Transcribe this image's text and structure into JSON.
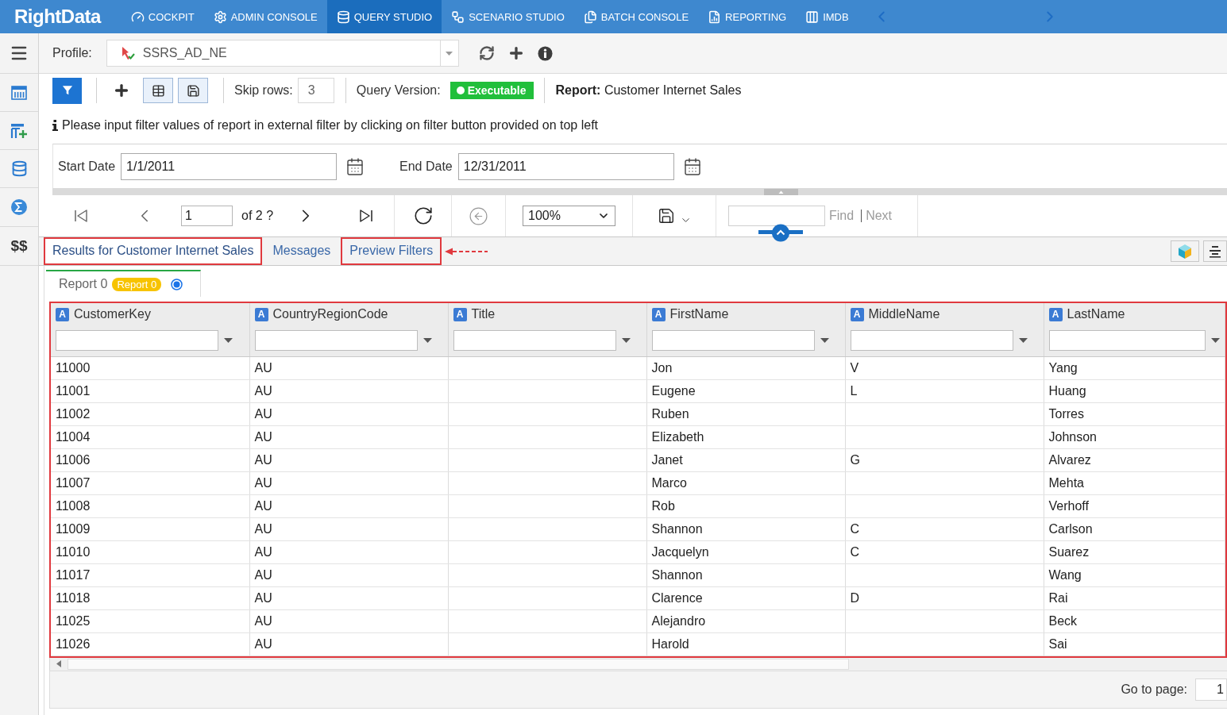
{
  "nav": {
    "logo": "RightData",
    "items": [
      {
        "label": "COCKPIT",
        "selected": false
      },
      {
        "label": "ADMIN CONSOLE",
        "selected": false
      },
      {
        "label": "QUERY STUDIO",
        "selected": true
      },
      {
        "label": "SCENARIO STUDIO",
        "selected": false
      },
      {
        "label": "BATCH CONSOLE",
        "selected": false
      },
      {
        "label": "REPORTING",
        "selected": false
      },
      {
        "label": "IMDB",
        "selected": false
      }
    ]
  },
  "sidebar": {
    "currency_label": "$$"
  },
  "profile": {
    "label": "Profile:",
    "value": "SSRS_AD_NE"
  },
  "toolbar": {
    "skip_rows_label": "Skip rows:",
    "skip_rows_value": "3",
    "query_version_label": "Query Version:",
    "query_version_status": "Executable",
    "report": "**Report:** Customer Internet Sales"
  },
  "info_message": "Please input filter values of report in external filter by clicking on filter button provided on top left",
  "parameters": [
    {
      "label": "Start Date",
      "value": "1/1/2011"
    },
    {
      "label": "End Date",
      "value": "12/31/2011"
    }
  ],
  "report_toolbar": {
    "page": "1",
    "page_count": "of 2 ?",
    "zoom": "100%",
    "find_label": "Find",
    "next_label": "Next"
  },
  "result_tabs": [
    {
      "label": "Results for Customer Internet Sales",
      "selected": true,
      "highlighted": true,
      "arrow": false
    },
    {
      "label": "Messages",
      "selected": false,
      "highlighted": false,
      "arrow": false
    },
    {
      "label": "Preview Filters",
      "selected": false,
      "highlighted": true,
      "arrow": true
    }
  ],
  "report_tabs": [
    {
      "label": "Report 0",
      "badge": "Report 0",
      "selected": true
    }
  ],
  "table": {
    "highlighted": true,
    "columns": [
      {
        "type_badge": "A",
        "name": "CustomerKey"
      },
      {
        "type_badge": "A",
        "name": "CountryRegionCode"
      },
      {
        "type_badge": "A",
        "name": "Title"
      },
      {
        "type_badge": "A",
        "name": "FirstName"
      },
      {
        "type_badge": "A",
        "name": "MiddleName"
      },
      {
        "type_badge": "A",
        "name": "LastName"
      }
    ],
    "rows": [
      [
        "11000",
        "AU",
        null,
        "Jon",
        "V",
        "Yang"
      ],
      [
        "11001",
        "AU",
        null,
        "Eugene",
        "L",
        "Huang"
      ],
      [
        "11002",
        "AU",
        null,
        "Ruben",
        null,
        "Torres"
      ],
      [
        "11004",
        "AU",
        null,
        "Elizabeth",
        null,
        "Johnson"
      ],
      [
        "11006",
        "AU",
        null,
        "Janet",
        "G",
        "Alvarez"
      ],
      [
        "11007",
        "AU",
        null,
        "Marco",
        null,
        "Mehta"
      ],
      [
        "11008",
        "AU",
        null,
        "Rob",
        null,
        "Verhoff"
      ],
      [
        "11009",
        "AU",
        null,
        "Shannon",
        "C",
        "Carlson"
      ],
      [
        "11010",
        "AU",
        null,
        "Jacquelyn",
        "C",
        "Suarez"
      ],
      [
        "11017",
        "AU",
        null,
        "Shannon",
        null,
        "Wang"
      ],
      [
        "11018",
        "AU",
        null,
        "Clarence",
        "D",
        "Rai"
      ],
      [
        "11025",
        "AU",
        null,
        "Alejandro",
        null,
        "Beck"
      ],
      [
        "11026",
        "AU",
        null,
        "Harold",
        null,
        "Sai"
      ]
    ]
  },
  "pager": {
    "go_to_page_label": "Go to page:",
    "go_to_page_value": "1"
  }
}
